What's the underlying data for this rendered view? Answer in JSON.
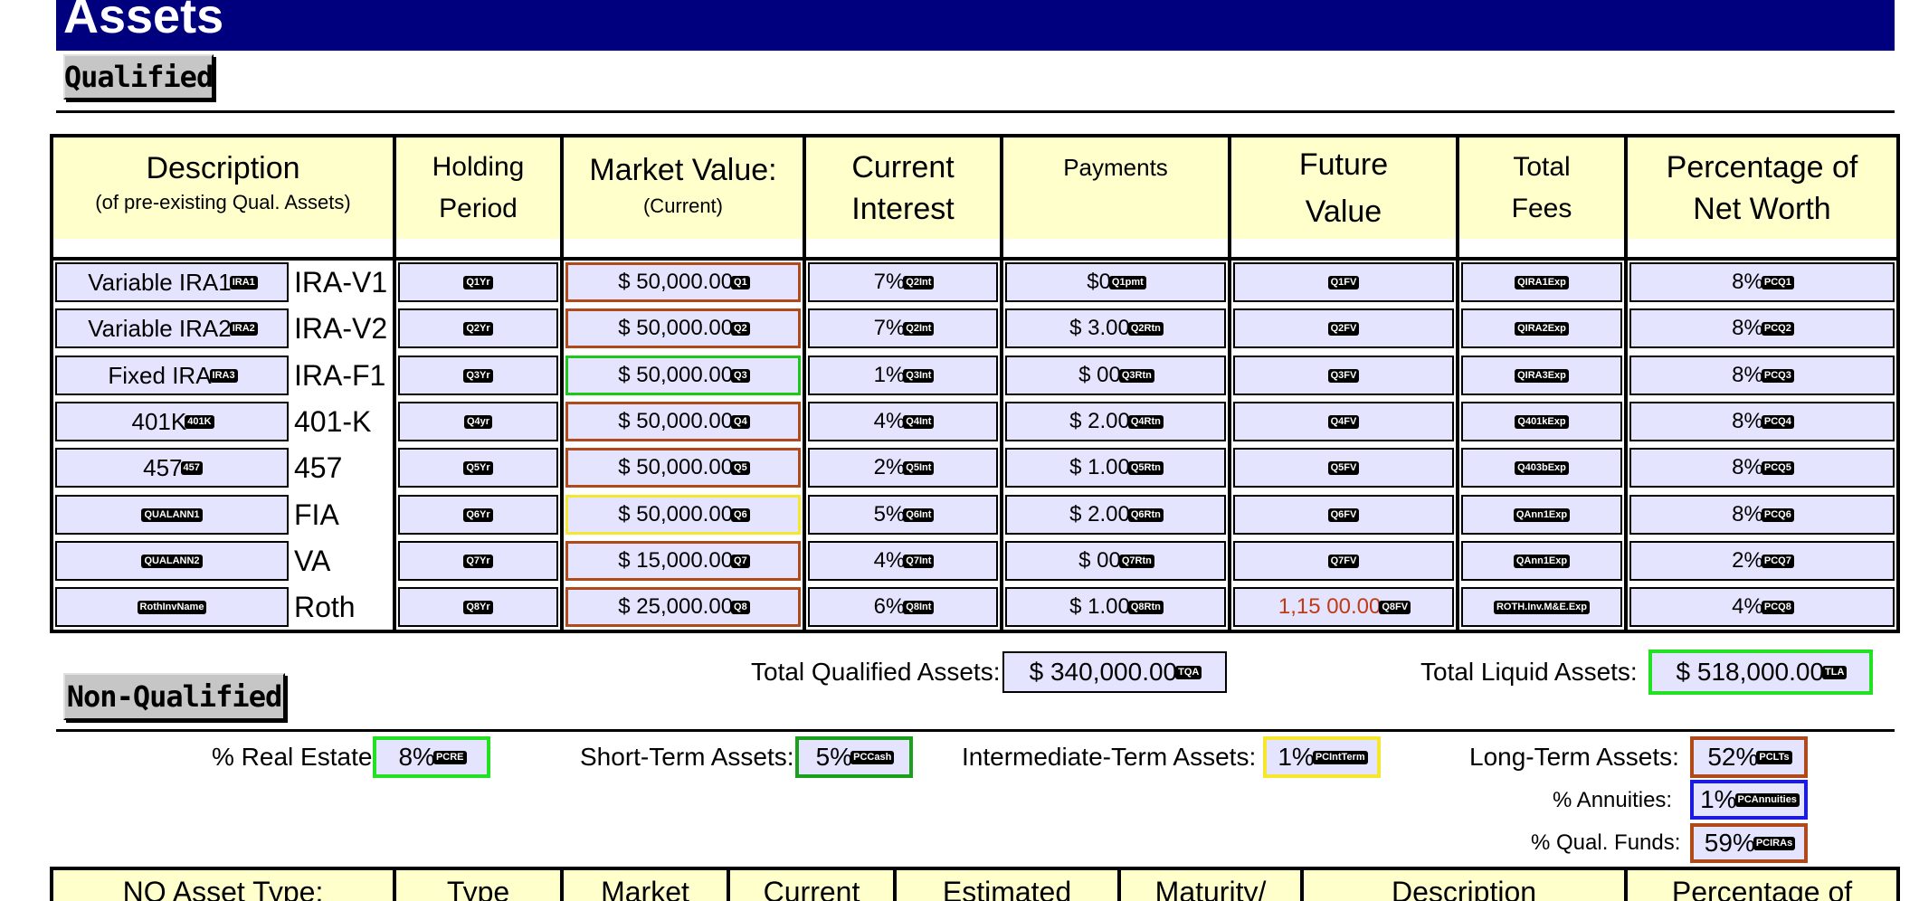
{
  "page": {
    "title": "Assets"
  },
  "sections": {
    "qualified": "Qualified",
    "non_qualified": "Non-Qualified"
  },
  "qualified_table": {
    "headers": [
      {
        "line1": "Description",
        "line2": "(of pre-existing Qual. Assets)"
      },
      {
        "line1": "Holding",
        "line2": "Period"
      },
      {
        "line1": "Market Value:",
        "line2": "(Current)"
      },
      {
        "line1": "Current",
        "line2": "Interest"
      },
      {
        "line1": "Payments",
        "line2": ""
      },
      {
        "line1": "Future",
        "line2": "Value"
      },
      {
        "line1": "Total",
        "line2": "Fees"
      },
      {
        "line1": "Percentage of",
        "line2": "Net Worth"
      }
    ],
    "rows": [
      {
        "desc": "Variable IRA1",
        "desc_tag": "IRA1",
        "label": "IRA-V1",
        "period_tag": "Q1Yr",
        "value": "$ 50,000.00",
        "value_tag": "Q1",
        "interest": "7%",
        "interest_tag": "Q2Int",
        "payment": "$0",
        "payment_tag": "Q1pmt",
        "fv_tag": "Q1FV",
        "fv": "",
        "fees_tag": "QIRA1Exp",
        "pct": "8%",
        "pct_tag": "PCQ1"
      },
      {
        "desc": "Variable IRA2",
        "desc_tag": "IRA2",
        "label": "IRA-V2",
        "period_tag": "Q2Yr",
        "value": "$ 50,000.00",
        "value_tag": "Q2",
        "interest": "7%",
        "interest_tag": "Q2Int",
        "payment": "$ 3.00",
        "payment_tag": "Q2Rtn",
        "fv_tag": "Q2FV",
        "fv": "",
        "fees_tag": "QIRA2Exp",
        "pct": "8%",
        "pct_tag": "PCQ2"
      },
      {
        "desc": "Fixed IRA",
        "desc_tag": "IRA3",
        "label": "IRA-F1",
        "period_tag": "Q3Yr",
        "value": "$ 50,000.00",
        "value_tag": "Q3",
        "interest": "1%",
        "interest_tag": "Q3Int",
        "payment": "$ 00",
        "payment_tag": "Q3Rtn",
        "fv_tag": "Q3FV",
        "fv": "",
        "fees_tag": "QIRA3Exp",
        "pct": "8%",
        "pct_tag": "PCQ3"
      },
      {
        "desc": "401K",
        "desc_tag": "401K",
        "label": "401-K",
        "period_tag": "Q4yr",
        "value": "$ 50,000.00",
        "value_tag": "Q4",
        "interest": "4%",
        "interest_tag": "Q4Int",
        "payment": "$ 2.00",
        "payment_tag": "Q4Rtn",
        "fv_tag": "Q4FV",
        "fv": "",
        "fees_tag": "Q401kExp",
        "pct": "8%",
        "pct_tag": "PCQ4"
      },
      {
        "desc": "457",
        "desc_tag": "457",
        "label": "457",
        "period_tag": "Q5Yr",
        "value": "$ 50,000.00",
        "value_tag": "Q5",
        "interest": "2%",
        "interest_tag": "Q5Int",
        "payment": "$ 1.00",
        "payment_tag": "Q5Rtn",
        "fv_tag": "Q5FV",
        "fv": "",
        "fees_tag": "Q403bExp",
        "pct": "8%",
        "pct_tag": "PCQ5"
      },
      {
        "desc": "",
        "desc_tag": "QUALANN1",
        "label": "FIA",
        "period_tag": "Q6Yr",
        "value": "$ 50,000.00",
        "value_tag": "Q6",
        "interest": "5%",
        "interest_tag": "Q6Int",
        "payment": "$ 2.00",
        "payment_tag": "Q6Rtn",
        "fv_tag": "Q6FV",
        "fv": "",
        "fees_tag": "QAnn1Exp",
        "pct": "8%",
        "pct_tag": "PCQ6"
      },
      {
        "desc": "",
        "desc_tag": "QUALANN2",
        "label": "VA",
        "period_tag": "Q7Yr",
        "value": "$ 15,000.00",
        "value_tag": "Q7",
        "interest": "4%",
        "interest_tag": "Q7Int",
        "payment": "$ 00",
        "payment_tag": "Q7Rtn",
        "fv_tag": "Q7FV",
        "fv": "",
        "fees_tag": "QAnn1Exp",
        "pct": "2%",
        "pct_tag": "PCQ7"
      },
      {
        "desc": "",
        "desc_tag": "RothInvName",
        "label": "Roth",
        "period_tag": "Q8Yr",
        "value": "$ 25,000.00",
        "value_tag": "Q8",
        "interest": "6%",
        "interest_tag": "Q8Int",
        "payment": "$ 1.00",
        "payment_tag": "Q8Rtn",
        "fv_tag": "Q8FV",
        "fv": "1,15 00.00",
        "fees_tag": "ROTH.Inv.M&E.Exp",
        "pct": "4%",
        "pct_tag": "PCQ8"
      }
    ]
  },
  "totals": {
    "qualified_label": "Total Qualified Assets:",
    "qualified_value": "$ 340,000.00",
    "qualified_tag": "TQA",
    "liquid_label": "Total Liquid Assets:",
    "liquid_value": "$ 518,000.00",
    "liquid_tag": "TLA"
  },
  "ratios": {
    "real_estate_label": "% Real Estate:",
    "real_estate_value": "8%",
    "real_estate_tag": "PCRE",
    "short_term_label": "Short-Term Assets:",
    "short_term_value": "5%",
    "short_term_tag": "PCCash",
    "intermediate_label": "Intermediate-Term Assets:",
    "intermediate_value": "1%",
    "intermediate_tag": "PCIntTerm",
    "long_term_label": "Long-Term Assets:",
    "long_term_value": "52%",
    "long_term_tag": "PCLTs",
    "annuities_label": "% Annuities:",
    "annuities_value": "1%",
    "annuities_tag": "PCAnnuities",
    "qual_funds_label": "% Qual. Funds:",
    "qual_funds_value": "59%",
    "qual_funds_tag": "PCIRAs"
  },
  "nq_table": {
    "headers": [
      "NQ Asset Type:",
      "Type",
      "Market",
      "Current",
      "Estimated",
      "Maturity/",
      "Description",
      "Percentage of"
    ]
  }
}
